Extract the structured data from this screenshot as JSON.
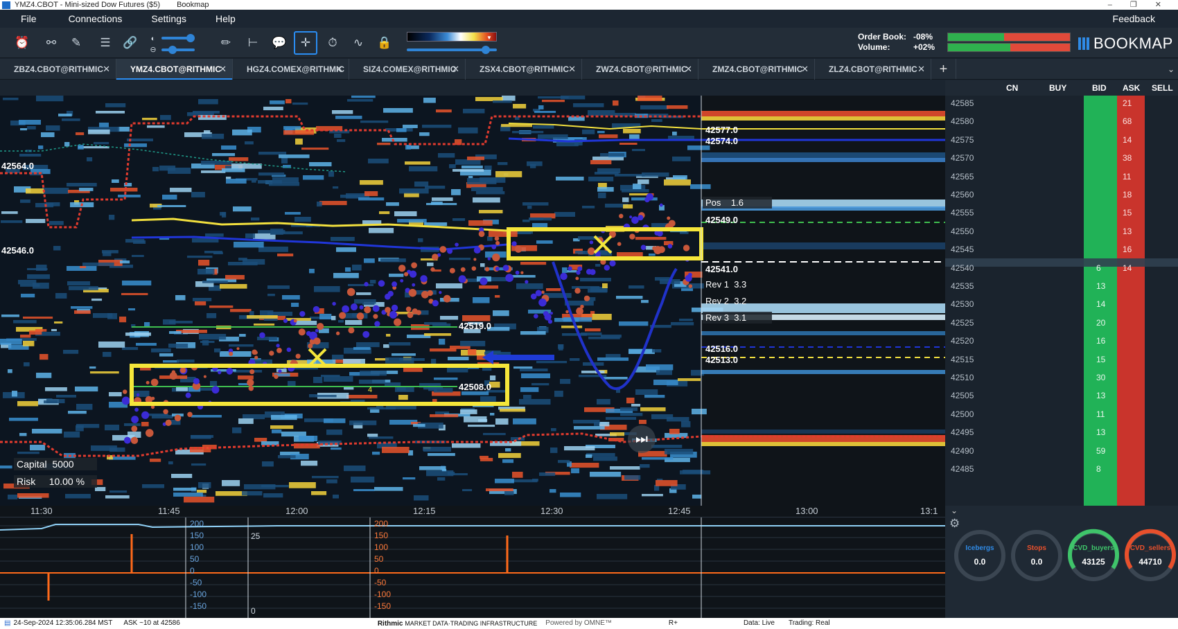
{
  "window": {
    "title": "YMZ4.CBOT - Mini-sized Dow Futures ($5)",
    "app_name": "Bookmap",
    "controls": [
      "–",
      "❐",
      "✕"
    ]
  },
  "menu": {
    "items": [
      "File",
      "Connections",
      "Settings",
      "Help"
    ],
    "feedback": "Feedback"
  },
  "toolbar": {
    "order_book_label": "Order Book:",
    "order_book_value": "-08%",
    "volume_label": "Volume:",
    "volume_value": "+02%",
    "brand": "BOOKMAP"
  },
  "tabs": [
    {
      "label": "ZBZ4.CBOT@RITHMIC",
      "active": false
    },
    {
      "label": "YMZ4.CBOT@RITHMIC",
      "active": true
    },
    {
      "label": "HGZ4.COMEX@RITHMIC",
      "active": false
    },
    {
      "label": "SIZ4.COMEX@RITHMIC",
      "active": false
    },
    {
      "label": "ZSX4.CBOT@RITHMIC",
      "active": false
    },
    {
      "label": "ZWZ4.CBOT@RITHMIC",
      "active": false
    },
    {
      "label": "ZMZ4.CBOT@RITHMIC",
      "active": false
    },
    {
      "label": "ZLZ4.CBOT@RITHMIC",
      "active": false
    }
  ],
  "tab_close": "✕",
  "tab_add": "+",
  "ladder": {
    "headers": {
      "cn": "CN",
      "buy": "BUY",
      "bid": "BID",
      "ask": "ASK",
      "sell": "SELL"
    },
    "prices": [
      "42585",
      "42580",
      "42575",
      "42570",
      "42565",
      "42560",
      "42555",
      "42550",
      "42545",
      "42540",
      "42535",
      "42530",
      "42525",
      "42520",
      "42515",
      "42510",
      "42505",
      "42500",
      "42495",
      "42490",
      "42485"
    ],
    "ask_sizes": [
      "21",
      "68",
      "14",
      "38",
      "11",
      "18",
      "15",
      "13",
      "16",
      "14",
      "",
      "",
      "",
      "",
      "",
      "",
      "",
      "",
      "",
      "",
      ""
    ],
    "bid_sizes": [
      "",
      "",
      "",
      "",
      "",
      "",
      "",
      "",
      "",
      "6",
      "13",
      "14",
      "20",
      "16",
      "15",
      "30",
      "13",
      "11",
      "13",
      "59",
      "8"
    ],
    "current_price": "42540",
    "current_marker": "1"
  },
  "chart": {
    "left_labels": [
      {
        "text": "42564.0"
      },
      {
        "text": "42546.0"
      }
    ],
    "right_labels": [
      {
        "text": "42577.0"
      },
      {
        "text": "42574.0"
      },
      {
        "text": "42549.0"
      },
      {
        "text": "42541.0"
      },
      {
        "text": "42519.0"
      },
      {
        "text": "42516.0"
      },
      {
        "text": "42513.0"
      },
      {
        "text": "42508.0"
      }
    ],
    "pos_label": "Pos",
    "pos_value": "1.6",
    "rev1_label": "Rev 1",
    "rev1_value": "3.3",
    "rev2_label": "Rev 2",
    "rev2_value": "3.2",
    "rev3_label": "Rev 3",
    "rev3_value": "3.1",
    "capital_label": "Capital",
    "capital_value": "5000",
    "risk_label": "Risk",
    "risk_value": "10.00 %",
    "small_marker": "4",
    "time_ticks": [
      "11:30",
      "11:45",
      "12:00",
      "12:15",
      "12:30",
      "12:45",
      "13:00",
      "13:1"
    ],
    "play_icon": "⏭"
  },
  "indicator": {
    "scale_a": [
      "200",
      "150",
      "100",
      "50",
      "0",
      "-50",
      "-100",
      "-150"
    ],
    "scale_b": [
      "200",
      "150",
      "100",
      "50",
      "0",
      "-50",
      "-100",
      "-150"
    ],
    "extra_a": "25",
    "extra_b": "0"
  },
  "gauges": [
    {
      "label": "Icebergs",
      "value": "0.0",
      "color": "#2f8ae5"
    },
    {
      "label": "Stops",
      "value": "0.0",
      "color": "#e8502c"
    },
    {
      "label": "CVD_buyers",
      "value": "43125",
      "color": "#3fc46a"
    },
    {
      "label": "CVD_sellers",
      "value": "44710",
      "color": "#e8502c"
    }
  ],
  "status": {
    "timestamp": "24-Sep-2024 12:35:06.284 MST",
    "ask_info": "ASK ~10 at 42586",
    "rithmic": "Rithmic",
    "rithmic_sub": "MARKET DATA·TRADING INFRASTRUCTURE",
    "omne": "Powered by OMNE™",
    "r_plus": "R+",
    "data": "Data: Live",
    "trading": "Trading: Real"
  },
  "colors": {
    "accent": "#2a8df2",
    "bid": "#2fb95a",
    "ask": "#d8453a",
    "yellow_box": "#f5e63a"
  }
}
